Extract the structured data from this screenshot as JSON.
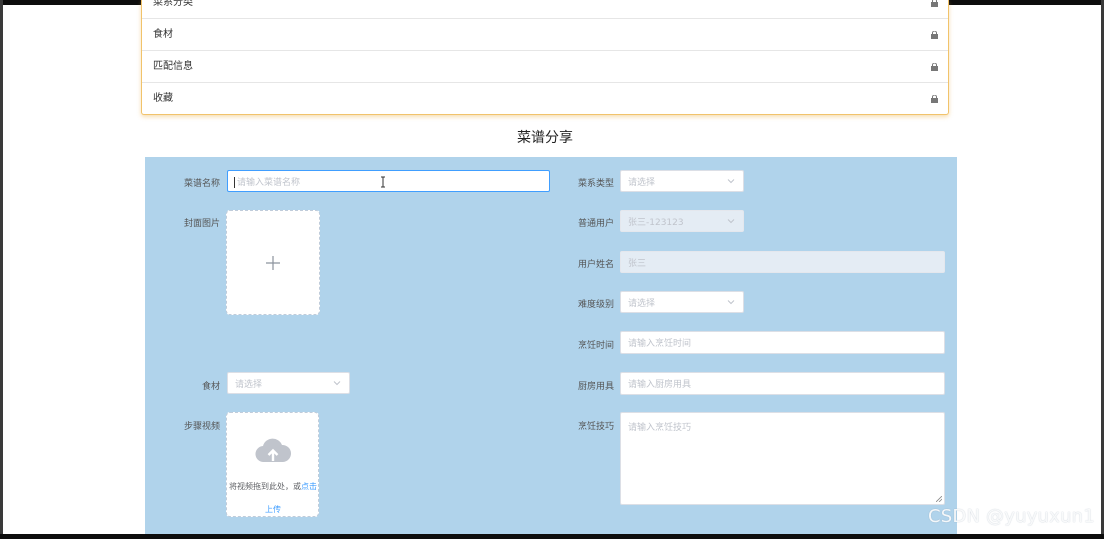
{
  "menu": {
    "items": [
      {
        "label": "菜系分类"
      },
      {
        "label": "食材"
      },
      {
        "label": "匹配信息"
      },
      {
        "label": "收藏"
      }
    ]
  },
  "section_title": "菜谱分享",
  "form": {
    "recipe_name": {
      "label": "菜谱名称",
      "placeholder": "请输入菜谱名称"
    },
    "cover_image": {
      "label": "封面图片"
    },
    "ingredients": {
      "label": "食材",
      "placeholder": "请选择"
    },
    "step_video": {
      "label": "步骤视频",
      "hint_prefix": "将视频拖到此处，或",
      "hint_link": "点击",
      "hint_link_2": "上传"
    },
    "cuisine_type": {
      "label": "菜系类型",
      "placeholder": "请选择"
    },
    "normal_user": {
      "label": "普通用户",
      "value": "张三-123123"
    },
    "user_name": {
      "label": "用户姓名",
      "value": "张三"
    },
    "difficulty": {
      "label": "难度级别",
      "placeholder": "请选择"
    },
    "cooking_time": {
      "label": "烹饪时间",
      "placeholder": "请输入烹饪时间"
    },
    "kitchen_tools": {
      "label": "厨房用具",
      "placeholder": "请输入厨房用具"
    },
    "cooking_skill": {
      "label": "烹饪技巧",
      "placeholder": "请输入烹饪技巧"
    }
  },
  "watermark": "CSDN @yuyuxun1",
  "colors": {
    "form_bg": "#b0d3eb",
    "menu_border": "#f1c36b",
    "focus": "#409eff",
    "link": "#409eff"
  },
  "icons": {
    "menu_item": "lock-icon",
    "select": "chevron-down-icon",
    "cover": "plus-icon",
    "video": "cloud-upload-icon"
  }
}
